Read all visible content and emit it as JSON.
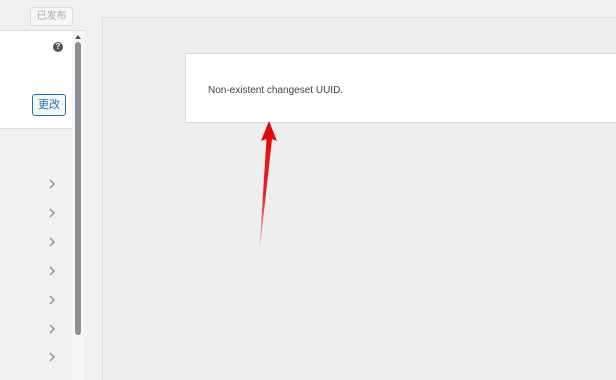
{
  "header": {
    "published_label": "已发布"
  },
  "info_panel": {
    "help_icon": "question-circle-icon",
    "help_glyph": "?",
    "change_label": "更改"
  },
  "sidebar": {
    "items": [
      {
        "icon": "chevron-right-icon"
      },
      {
        "icon": "chevron-right-icon"
      },
      {
        "icon": "chevron-right-icon"
      },
      {
        "icon": "chevron-right-icon"
      },
      {
        "icon": "chevron-right-icon"
      },
      {
        "icon": "chevron-right-icon"
      },
      {
        "icon": "chevron-right-icon"
      }
    ]
  },
  "preview": {
    "notice_text": "Non-existent changeset UUID."
  },
  "colors": {
    "accent": "#2271b1",
    "arrow": "#e00000",
    "background": "#f0f0f1"
  }
}
